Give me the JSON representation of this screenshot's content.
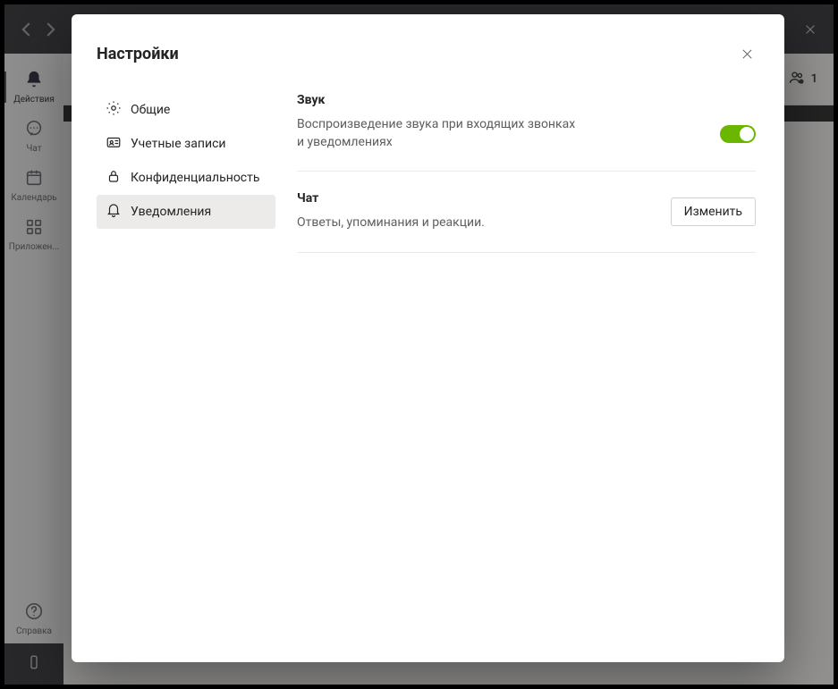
{
  "rail": {
    "items": [
      {
        "label": "Действия"
      },
      {
        "label": "Чат"
      },
      {
        "label": "Календарь"
      },
      {
        "label": "Приложен..."
      }
    ],
    "help": "Справка"
  },
  "header_meet_count": "1",
  "modal": {
    "title": "Настройки",
    "nav": [
      {
        "label": "Общие"
      },
      {
        "label": "Учетные записи"
      },
      {
        "label": "Конфиденциальность"
      },
      {
        "label": "Уведомления"
      }
    ],
    "sound": {
      "title": "Звук",
      "desc": "Воспроизведение звука при входящих звонках и уведомлениях"
    },
    "chat": {
      "title": "Чат",
      "desc": "Ответы, упоминания и реакции.",
      "button": "Изменить"
    }
  }
}
